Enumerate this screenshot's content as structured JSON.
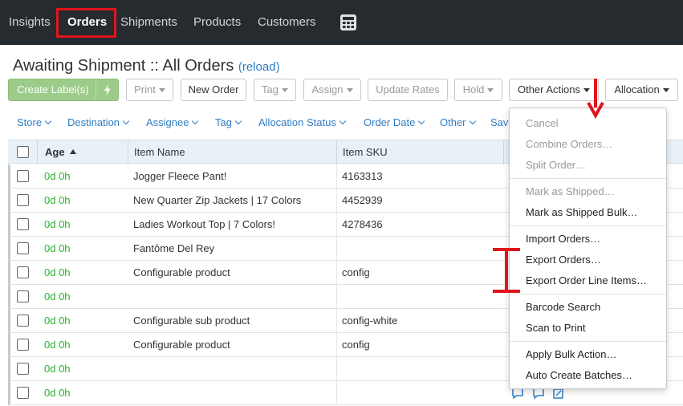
{
  "nav": {
    "items": [
      {
        "label": "Insights"
      },
      {
        "label": "Orders"
      },
      {
        "label": "Shipments"
      },
      {
        "label": "Products"
      },
      {
        "label": "Customers"
      }
    ]
  },
  "page": {
    "title": "Awaiting Shipment :: All Orders",
    "reload": "reload"
  },
  "toolbar": {
    "create_label": "Create Label(s)",
    "print": "Print",
    "new_order": "New Order",
    "tag": "Tag",
    "assign": "Assign",
    "update_rates": "Update Rates",
    "hold": "Hold",
    "other_actions": "Other Actions",
    "allocation": "Allocation"
  },
  "filters": {
    "items": [
      "Store",
      "Destination",
      "Assignee",
      "Tag",
      "Allocation Status",
      "Order Date",
      "Other",
      "Save"
    ]
  },
  "table": {
    "headers": {
      "age": "Age",
      "item_name": "Item Name",
      "item_sku": "Item SKU"
    },
    "rows": [
      {
        "age": "0d 0h",
        "item_name": "Jogger Fleece Pant!",
        "item_sku": "4163313"
      },
      {
        "age": "0d 0h",
        "item_name": "New Quarter Zip Jackets | 17 Colors",
        "item_sku": "4452939"
      },
      {
        "age": "0d 0h",
        "item_name": "Ladies Workout Top | 7 Colors!",
        "item_sku": "4278436"
      },
      {
        "age": "0d 0h",
        "item_name": "Fantôme Del Rey",
        "item_sku": ""
      },
      {
        "age": "0d 0h",
        "item_name": "Configurable product",
        "item_sku": "config"
      },
      {
        "age": "0d 0h",
        "item_name": "",
        "item_sku": ""
      },
      {
        "age": "0d 0h",
        "item_name": "Configurable sub product",
        "item_sku": "config-white"
      },
      {
        "age": "0d 0h",
        "item_name": "Configurable product",
        "item_sku": "config"
      },
      {
        "age": "0d 0h",
        "item_name": "",
        "item_sku": ""
      },
      {
        "age": "0d 0h",
        "item_name": "",
        "item_sku": ""
      }
    ]
  },
  "other_actions_menu": {
    "items": [
      {
        "label": "Cancel",
        "enabled": false
      },
      {
        "label": "Combine Orders…",
        "enabled": false
      },
      {
        "label": "Split Order…",
        "enabled": false
      },
      {
        "label": "Mark as Shipped…",
        "enabled": false
      },
      {
        "label": "Mark as Shipped Bulk…",
        "enabled": true
      },
      {
        "label": "Import Orders…",
        "enabled": true
      },
      {
        "label": "Export Orders…",
        "enabled": true
      },
      {
        "label": "Export Order Line Items…",
        "enabled": true
      },
      {
        "label": "Barcode Search",
        "enabled": true
      },
      {
        "label": "Scan to Print",
        "enabled": true
      },
      {
        "label": "Apply Bulk Action…",
        "enabled": true
      },
      {
        "label": "Auto Create Batches…",
        "enabled": true
      }
    ]
  },
  "icons": {
    "calculator": "calculator-icon",
    "bolt": "lightning-bolt-icon",
    "sort": "sort-ascending-icon"
  },
  "colors": {
    "nav_bg": "#262b2f",
    "link": "#2f7dc4",
    "age_green": "#2bb02b",
    "create_label_green": "#9ccb8a",
    "annotation_red": "#e1141b",
    "header_bg": "#e8f0f8"
  }
}
